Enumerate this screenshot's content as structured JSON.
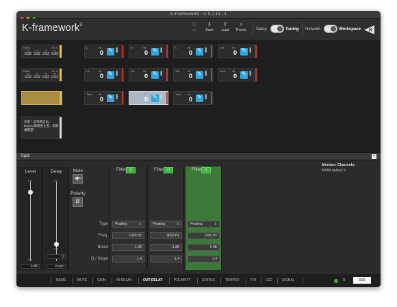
{
  "window": {
    "title": "K-Framework3 - v. 0.7.13 - 1"
  },
  "app": {
    "brand": "K-framework",
    "brand_sup": "3"
  },
  "toolbar": {
    "buttons": [
      {
        "label": "Info",
        "glyph": "⊙"
      },
      {
        "label": "Save",
        "glyph": "⇩"
      },
      {
        "label": "Load",
        "glyph": "⇧"
      },
      {
        "label": "Theme",
        "glyph": "♀"
      }
    ],
    "setup_label": "Setup",
    "tuning_label": "Tuning",
    "network_label": "Network",
    "workspace_label": "Workspace",
    "logo": "K"
  },
  "amps": [
    {
      "name": "KA84",
      "id": "ID: 1",
      "cols": [
        {
          "h": "mI",
          "v": "0.02"
        },
        {
          "h": "mI",
          "v": "0.02"
        },
        {
          "h": "mI",
          "v": "0.02"
        },
        {
          "h": "mI",
          "v": "0.02"
        }
      ]
    },
    {
      "name": "KA84",
      "id": "ID: 2",
      "cols": [
        {
          "h": "mI",
          "v": "0.02"
        },
        {
          "h": "mI",
          "v": "0.02"
        },
        {
          "h": "mI",
          "v": "0.02"
        },
        {
          "h": "mI",
          "v": "0.02"
        }
      ]
    },
    {
      "name": "",
      "id": "",
      "cols": []
    }
  ],
  "note": {
    "text": "注意！此項目自由。Dante3請檢查之后，再新請靜室！"
  },
  "tiles": [
    {
      "label": "L",
      "db": "dB",
      "value": "0"
    },
    {
      "label": "R",
      "db": "dB",
      "value": "0"
    },
    {
      "label": "C",
      "db": "dB",
      "value": "0"
    },
    {
      "label": "LFE",
      "db": "dB",
      "value": "0"
    },
    {
      "label": "LS",
      "db": "dB",
      "value": "0"
    },
    {
      "label": "RS",
      "db": "dB",
      "value": "0"
    },
    {
      "label": "SW",
      "db": "dB",
      "value": "0"
    },
    {
      "label": "Top1",
      "db": "dB",
      "value": "0"
    },
    {
      "label": "Top2",
      "db": "dB",
      "value": "0"
    },
    {
      "label": "",
      "db": "dB",
      "value": "0"
    },
    {
      "label": "Top4",
      "db": "dB",
      "value": "0"
    }
  ],
  "panel": {
    "title": "Top3",
    "close_glyph": "×",
    "level_label": "Level",
    "level_value": "0 dB",
    "delay_label": "Delay",
    "delay_value": "0",
    "delay_unit": "msec",
    "mute_label": "Mute",
    "mute_glyph": "◀×",
    "polarity_label": "Polarity",
    "polarity_glyph": "Ø",
    "row_labels": [
      "Type",
      "Freq.",
      "Boost",
      "Q / Slope"
    ],
    "filters": [
      {
        "header": "Filter",
        "type": "Peaking",
        "freq": "1000 Hz",
        "boost": "-1 dB",
        "q": "1.4"
      },
      {
        "header": "Filter",
        "type": "Peaking",
        "freq": "9000 Hz",
        "boost": "-3 dB",
        "q": "1.4"
      },
      {
        "header": "Filter",
        "type": "Peaking",
        "freq": "1000 Hz",
        "boost": "0 dB",
        "q": "1.4"
      }
    ],
    "member_title": "Member Channels:",
    "member_value": "KA84 output 2"
  },
  "bottom": {
    "tabs": [
      "NAME",
      "MUTE",
      "GAIN",
      "IN-DELAY",
      "OUT-DELAY",
      "POLARITY",
      "STATUS",
      "TEMPER",
      "FIR",
      "LED",
      "SIGNAL"
    ],
    "active_tab": "OUT-DELAY",
    "led_count": "0",
    "ms_value": "500"
  },
  "colors": {
    "accent_blue": "#2ea6e0",
    "green": "#3fae3c",
    "amp_bar": "#e6c34a",
    "selected_tile": "#a9b8c4"
  }
}
